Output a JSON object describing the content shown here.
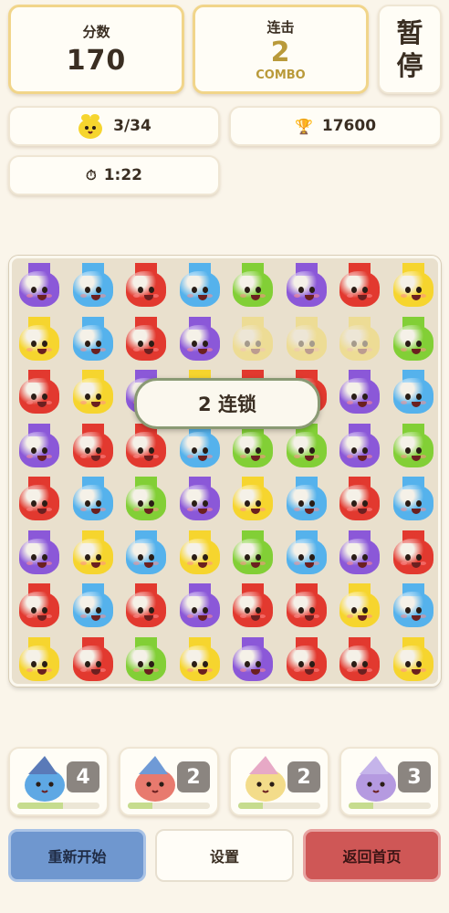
{
  "score": {
    "label": "分数",
    "value": "170"
  },
  "combo": {
    "label": "连击",
    "value": "2",
    "sub": "COMBO"
  },
  "pause": {
    "label": "暂停"
  },
  "progress": {
    "text": "3/34"
  },
  "target": {
    "text": "17600"
  },
  "timer": {
    "text": "1:22"
  },
  "chain_popup": {
    "text": "2 连锁"
  },
  "board": {
    "rows": 8,
    "cols": 8,
    "colors": {
      "purple": "#8b58d8",
      "blue": "#55b2ec",
      "red": "#e2392f",
      "yellow": "#f6d52e",
      "green": "#82cf36"
    },
    "grid": [
      [
        "purple",
        "blue",
        "red",
        "blue",
        "green",
        "purple",
        "red",
        "yellow"
      ],
      [
        "yellow",
        "blue",
        "red",
        "purple",
        "yellow*",
        "yellow*",
        "yellow*",
        "green"
      ],
      [
        "red",
        "yellow",
        "purple",
        "yellow",
        "red",
        "red",
        "purple",
        "blue"
      ],
      [
        "purple",
        "red",
        "red",
        "blue",
        "green",
        "green",
        "purple",
        "green"
      ],
      [
        "red",
        "blue",
        "green",
        "purple",
        "yellow",
        "blue",
        "red",
        "blue"
      ],
      [
        "purple",
        "yellow",
        "blue",
        "yellow",
        "green",
        "blue",
        "purple",
        "red"
      ],
      [
        "red",
        "blue",
        "red",
        "purple",
        "red",
        "red",
        "yellow",
        "blue"
      ],
      [
        "yellow",
        "red",
        "green",
        "yellow",
        "purple",
        "red",
        "red",
        "yellow"
      ]
    ]
  },
  "powerups": [
    {
      "name": "wizard-slime",
      "count": "4",
      "fill": 0.55,
      "color": "#5ea8e4",
      "hat": "#5a7ab8"
    },
    {
      "name": "cap-slime",
      "count": "2",
      "fill": 0.3,
      "color": "#e87a6e",
      "hat": "#6f9ad6"
    },
    {
      "name": "rainbow-slime",
      "count": "2",
      "fill": 0.3,
      "color": "#f3dc8a",
      "hat": "#e7a9c6"
    },
    {
      "name": "sleepy-slime",
      "count": "3",
      "fill": 0.3,
      "color": "#b59ae0",
      "hat": "#c5b4ea"
    }
  ],
  "buttons": {
    "restart": "重新开始",
    "settings": "设置",
    "home": "返回首页"
  }
}
